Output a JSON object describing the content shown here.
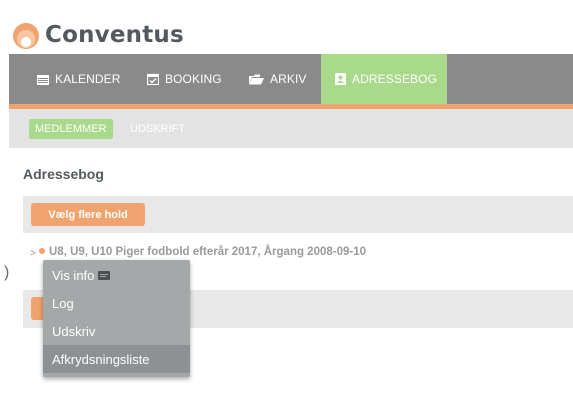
{
  "brand": {
    "name": "Conventus",
    "accent": "#f0a36c",
    "active": "#a9d98a"
  },
  "nav": {
    "tabs": [
      {
        "label": "KALENDER",
        "icon": "calendar-icon"
      },
      {
        "label": "BOOKING",
        "icon": "calendar-check-icon"
      },
      {
        "label": "ARKIV",
        "icon": "folder-icon"
      },
      {
        "label": "ADRESSEBOG",
        "icon": "address-book-icon",
        "active": true
      }
    ]
  },
  "subnav": {
    "items": [
      {
        "label": "MEDLEMMER",
        "active": true
      },
      {
        "label": "UDSKRIFT",
        "active": false
      }
    ]
  },
  "page": {
    "title": "Adressebog"
  },
  "toolbar": {
    "select_groups_label": "Vælg flere hold"
  },
  "groups": [
    {
      "label": "U8, U9, U10 Piger fodbold efterår 2017, Årgang 2008-09-10"
    }
  ],
  "context_menu": {
    "items": [
      {
        "label": "Vis info",
        "icon": "info-card-icon"
      },
      {
        "label": "Log"
      },
      {
        "label": "Udskriv"
      },
      {
        "label": "Afkrydsningsliste",
        "highlighted": true
      }
    ]
  }
}
